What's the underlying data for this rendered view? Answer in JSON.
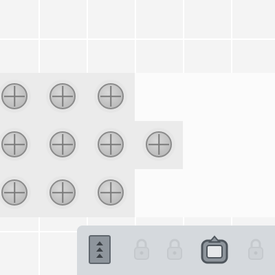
{
  "colors": {
    "board_bg": "#f4f4f4",
    "toolbar_bg": "#d5d9dd",
    "bolt_fill": "#c3c3c3",
    "bolt_stroke": "#8a8a8a",
    "button_fill": "#8e959c",
    "button_stroke": "#5f666d",
    "lock_color": "#b8bcc0"
  },
  "board": {
    "bolt_rows": [
      [
        1,
        1,
        1,
        0
      ],
      [
        1,
        1,
        1,
        1
      ],
      [
        1,
        1,
        1,
        0
      ]
    ]
  },
  "toolbar": {
    "items": [
      {
        "icon": "layers-icon",
        "state": "active"
      },
      {
        "icon": "lock-icon",
        "state": "locked"
      },
      {
        "icon": "lock-icon",
        "state": "locked"
      },
      {
        "icon": "rotate-icon",
        "state": "active"
      },
      {
        "icon": "lock-icon",
        "state": "locked"
      }
    ]
  }
}
